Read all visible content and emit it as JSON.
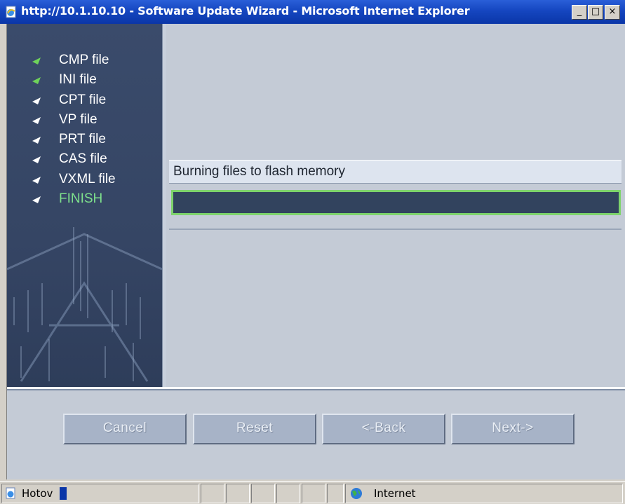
{
  "window": {
    "title": "http://10.1.10.10 - Software Update Wizard - Microsoft Internet Explorer",
    "minimize_label": "_",
    "maximize_label": "□",
    "close_label": "×"
  },
  "sidebar": {
    "steps": [
      {
        "label": "CMP file",
        "state": "done"
      },
      {
        "label": "INI file",
        "state": "done"
      },
      {
        "label": "CPT file",
        "state": "pending"
      },
      {
        "label": "VP file",
        "state": "pending"
      },
      {
        "label": "PRT file",
        "state": "pending"
      },
      {
        "label": "CAS file",
        "state": "pending"
      },
      {
        "label": "VXML file",
        "state": "pending"
      },
      {
        "label": "FINISH",
        "state": "active"
      }
    ]
  },
  "main": {
    "status_message": "Burning files to flash memory",
    "progress_fraction": 0
  },
  "buttons": {
    "cancel": "Cancel",
    "reset": "Reset",
    "back": "<-Back",
    "next": "Next->"
  },
  "statusbar": {
    "page_status": "Hotov",
    "zone_label": "Internet",
    "zone_icon": "globe-icon"
  },
  "colors": {
    "done_bullet": "#6fd35a",
    "pending_bullet": "#ffffff",
    "active_label": "#7ee08c",
    "progress_border": "#7ed36c"
  }
}
